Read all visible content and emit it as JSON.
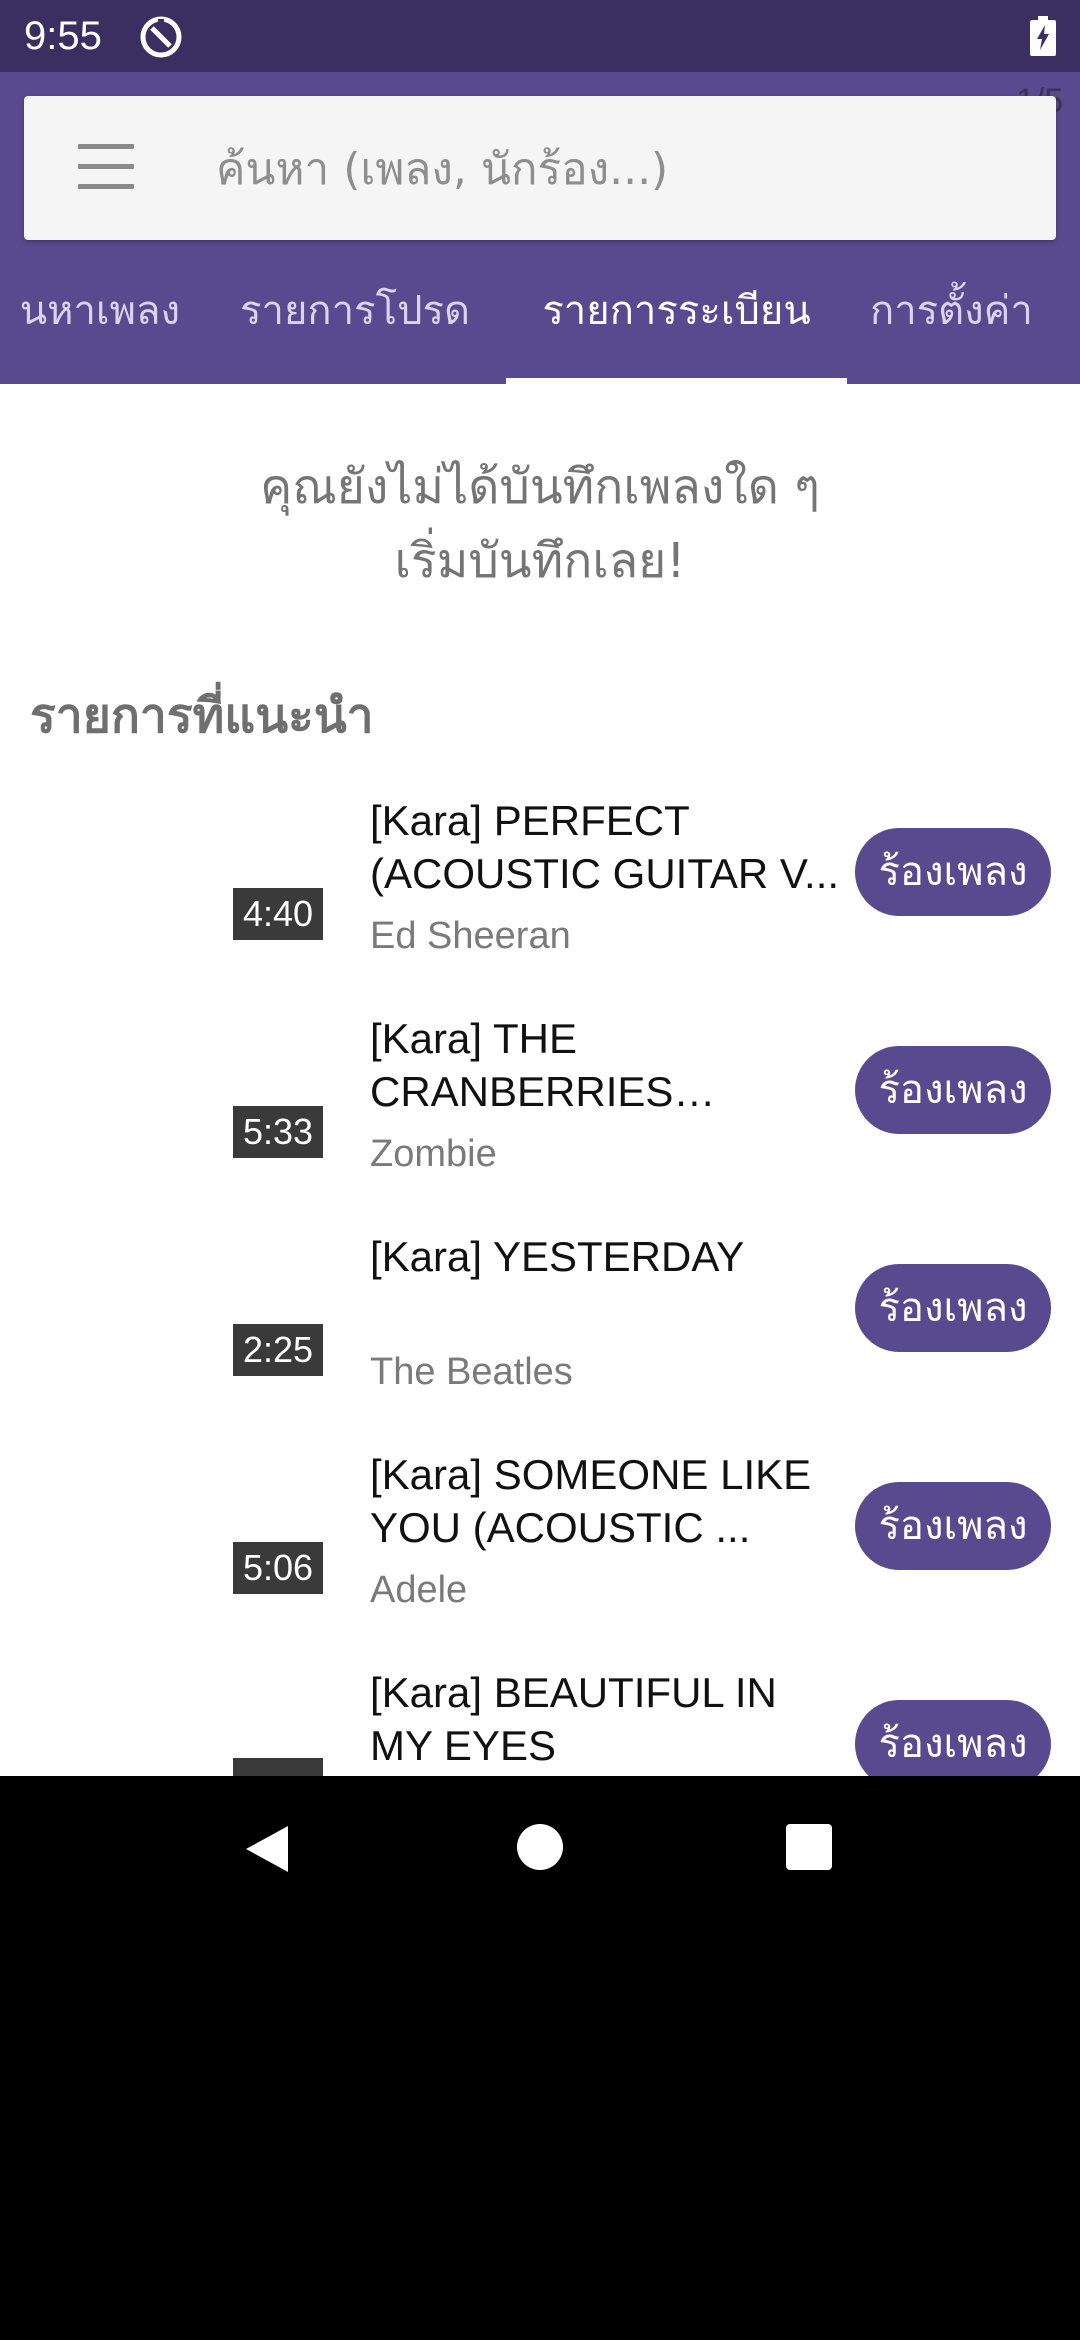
{
  "status_bar": {
    "time": "9:55"
  },
  "app_bar": {
    "page_indicator": "1/5",
    "search": {
      "placeholder": "ค้นหา (เพลง, นักร้อง...)"
    },
    "tabs": [
      {
        "label": "ค้นหาเพลง",
        "visible_label": "นหาเพลง"
      },
      {
        "label": "รายการโปรด"
      },
      {
        "label": "รายการระเบียน",
        "active": true
      },
      {
        "label": "การตั้งค่า"
      }
    ]
  },
  "content": {
    "empty_message_line1": "คุณยังไม่ได้บันทึกเพลงใด ๆ",
    "empty_message_line2": "เริ่มบันทึกเลย!",
    "section_title": "รายการที่แนะนำ",
    "sing_label": "ร้องเพลง",
    "songs": [
      {
        "duration": "4:40",
        "title": "[Kara] PERFECT (ACOUSTIC GUITAR V...",
        "artist": "Ed Sheeran"
      },
      {
        "duration": "5:33",
        "title": "[Kara] THE CRANBERRIES (ACOU...",
        "artist": "Zombie"
      },
      {
        "duration": "2:25",
        "title": "[Kara] YESTERDAY",
        "artist": "The Beatles"
      },
      {
        "duration": "5:06",
        "title": "[Kara] SOMEONE LIKE YOU (ACOUSTIC ...",
        "artist": "Adele"
      },
      {
        "duration": "",
        "title": "[Kara] BEAUTIFUL IN MY EYES",
        "artist": ""
      }
    ]
  },
  "colors": {
    "status_bar": "#3a2f60",
    "app_bar": "#574a8e",
    "accent": "#574a8e"
  },
  "icons": {
    "status": [
      "sync-icon",
      "battery-charging-icon"
    ],
    "search": "menu-icon",
    "navigation": [
      "back-icon",
      "home-icon",
      "recents-icon"
    ]
  }
}
